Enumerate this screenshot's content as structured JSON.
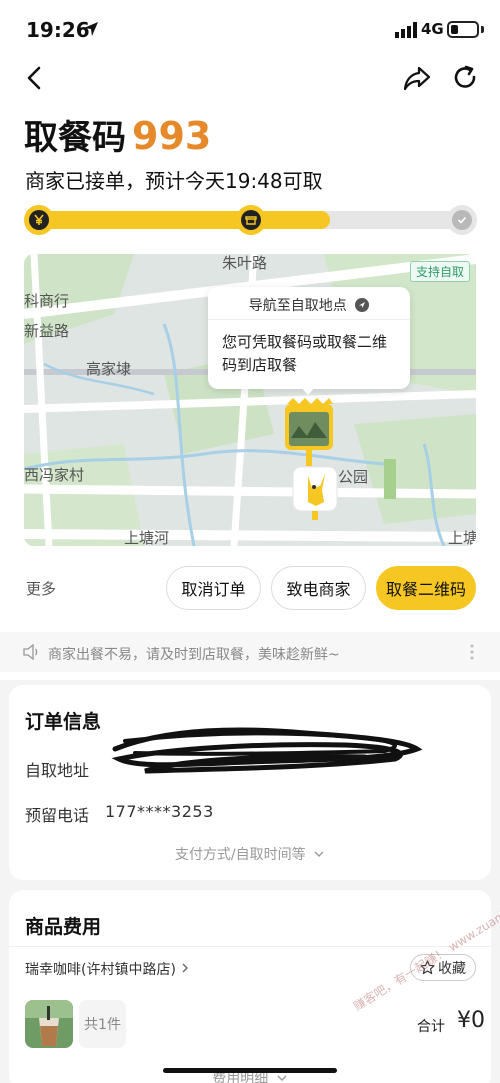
{
  "status_bar": {
    "time": "19:26",
    "network": "4G",
    "battery_level": 0.3
  },
  "header": {
    "pickup_label": "取餐码",
    "pickup_code": "993",
    "status": "商家已接单，预计今天19:48可取"
  },
  "progress": {
    "fraction": 0.68,
    "steps": [
      "¥",
      "store",
      "check"
    ]
  },
  "map": {
    "badge": "支持自取",
    "labels": [
      "朱叶路",
      "科商行",
      "新益路",
      "高家埭",
      "西冯家村",
      "公园",
      "上塘河",
      "上塘"
    ],
    "callout_title": "导航至自取地点",
    "callout_body": "您可凭取餐码或取餐二维码到店取餐"
  },
  "actions": {
    "more": "更多",
    "cancel": "取消订单",
    "call": "致电商家",
    "qr": "取餐二维码"
  },
  "notice": "商家出餐不易，请及时到店取餐，美味趁新鲜~",
  "order_info": {
    "title": "订单信息",
    "address_label": "自取地址",
    "phone_label": "预留电话",
    "phone": "177****3253",
    "more": "支付方式/自取时间等"
  },
  "goods": {
    "title": "商品费用",
    "store": "瑞幸咖啡(许村镇中路店)",
    "favorite": "收藏",
    "count": "共1件",
    "total_label": "合计",
    "total_value": "¥0",
    "fee_detail": "费用明细"
  },
  "watermark": "赚客吧，有一起赚！ www.zuanke8",
  "colors": {
    "brand_yellow": "#f6c623",
    "code_orange": "#e5892a"
  }
}
